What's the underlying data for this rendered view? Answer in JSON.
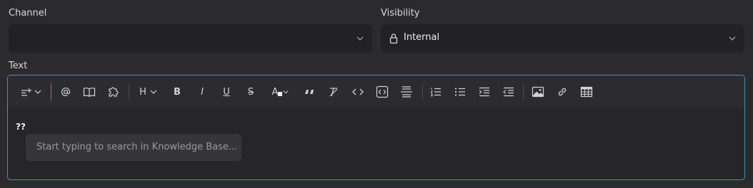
{
  "channel": {
    "label": "Channel",
    "value": ""
  },
  "visibility": {
    "label": "Visibility",
    "value": "Internal"
  },
  "text_label": "Text",
  "toolbar": {
    "heading_label": "H",
    "bold_label": "B",
    "italic_label": "I",
    "underline_label": "U",
    "strike_label": "S",
    "text_color_label": "A"
  },
  "editor": {
    "content": "??",
    "suggestion_placeholder": "Start typing to search in Knowledge Base..."
  },
  "colors": {
    "accent": "#2f9ac6",
    "divider_red": "#c2566a"
  }
}
